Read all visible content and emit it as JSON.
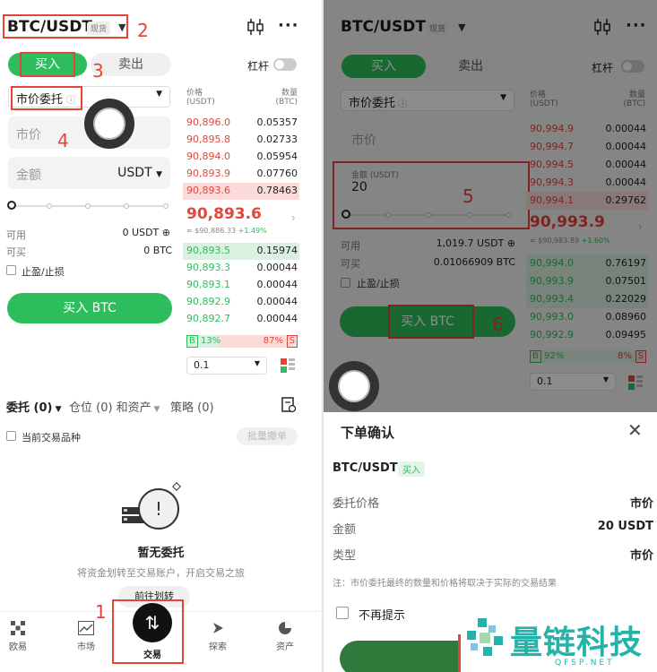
{
  "left": {
    "pair": "BTC/USDT",
    "spot_tag": "现货",
    "buy_tab": "买入",
    "sell_tab": "卖出",
    "leverage_label": "杠杆",
    "order_type": "市价委托",
    "price_placeholder": "市价",
    "amount_placeholder": "金额",
    "amount_unit": "USDT",
    "available_label": "可用",
    "available_value": "0 USDT",
    "buyable_label": "可买",
    "buyable_value": "0 BTC",
    "tpsl_label": "止盈/止损",
    "buy_button": "买入 BTC",
    "ob_price_header": "价格",
    "ob_price_unit": "(USDT)",
    "ob_qty_header": "数量",
    "ob_qty_unit": "(BTC)",
    "asks": [
      {
        "price": "90,896.0",
        "qty": "0.05357"
      },
      {
        "price": "90,895.8",
        "qty": "0.02733"
      },
      {
        "price": "90,894.0",
        "qty": "0.05954"
      },
      {
        "price": "90,893.9",
        "qty": "0.07760"
      },
      {
        "price": "90,893.6",
        "qty": "0.78463"
      }
    ],
    "last_price": "90,893.6",
    "last_sub": "≈ $90,886.33",
    "last_change": "+1.49%",
    "bids": [
      {
        "price": "90,893.5",
        "qty": "0.15974"
      },
      {
        "price": "90,893.3",
        "qty": "0.00044"
      },
      {
        "price": "90,893.1",
        "qty": "0.00044"
      },
      {
        "price": "90,892.9",
        "qty": "0.00044"
      },
      {
        "price": "90,892.7",
        "qty": "0.00044"
      }
    ],
    "b_label": "B",
    "b_pct": "13%",
    "s_pct": "87%",
    "s_label": "S",
    "precision": "0.1",
    "tabs_orders": "委托 (0)",
    "tabs_positions": "仓位 (0) 和资产",
    "tabs_strategy": "策略 (0)",
    "current_pair_label": "当前交易品种",
    "batch_cancel": "批量撤单",
    "empty_title": "暂无委托",
    "empty_desc": "将资金划转至交易账户，开启交易之旅",
    "transfer_button": "前往划转",
    "nav": [
      {
        "label": "欧易",
        "icon": "okx-logo-icon"
      },
      {
        "label": "市场",
        "icon": "market-chart-icon"
      },
      {
        "label": "交易",
        "icon": "trade-swap-icon"
      },
      {
        "label": "探索",
        "icon": "explore-compass-icon"
      },
      {
        "label": "资产",
        "icon": "assets-pie-icon"
      }
    ],
    "steps": [
      "1",
      "2",
      "3",
      "4"
    ]
  },
  "right": {
    "pair": "BTC/USDT",
    "spot_tag": "现货",
    "buy_tab": "买入",
    "sell_tab": "卖出",
    "leverage_label": "杠杆",
    "order_type": "市价委托",
    "price_placeholder": "市价",
    "amount_label": "金额 (USDT)",
    "amount_value": "20",
    "available_label": "可用",
    "available_value": "1,019.7 USDT",
    "buyable_label": "可买",
    "buyable_value": "0.01066909 BTC",
    "tpsl_label": "止盈/止损",
    "buy_button": "买入 BTC",
    "ob_price_header": "价格",
    "ob_price_unit": "(USDT)",
    "ob_qty_header": "数量",
    "ob_qty_unit": "(BTC)",
    "asks": [
      {
        "price": "90,994.9",
        "qty": "0.00044"
      },
      {
        "price": "90,994.7",
        "qty": "0.00044"
      },
      {
        "price": "90,994.5",
        "qty": "0.00044"
      },
      {
        "price": "90,994.3",
        "qty": "0.00044"
      },
      {
        "price": "90,994.1",
        "qty": "0.29762"
      }
    ],
    "last_price": "90,993.9",
    "last_sub": "≈ $90,983.89",
    "last_change": "+1.60%",
    "bids": [
      {
        "price": "90,994.0",
        "qty": "0.76197"
      },
      {
        "price": "90,993.9",
        "qty": "0.07501"
      },
      {
        "price": "90,993.4",
        "qty": "0.22029"
      },
      {
        "price": "90,993.0",
        "qty": "0.08960"
      },
      {
        "price": "90,992.9",
        "qty": "0.09495"
      }
    ],
    "b_label": "B",
    "b_pct": "92%",
    "s_pct": "8%",
    "s_label": "S",
    "precision": "0.1",
    "steps": [
      "5",
      "6"
    ],
    "confirm": {
      "title": "下单确认",
      "pair": "BTC/USDT",
      "side": "买入",
      "rows": [
        {
          "k": "委托价格",
          "v": "市价"
        },
        {
          "k": "金额",
          "v": "20 USDT"
        },
        {
          "k": "类型",
          "v": "市价"
        }
      ],
      "note": "注：市价委托最终的数量和价格将取决于实际的交易结果",
      "dont_remind": "不再提示"
    },
    "watermark_name": "量链科技",
    "watermark_url": "QFSP.NET"
  }
}
